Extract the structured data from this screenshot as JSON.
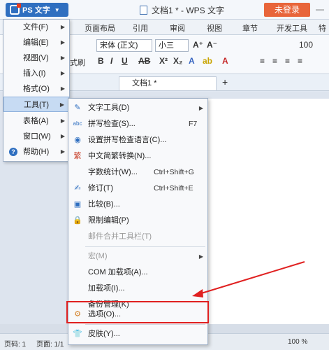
{
  "app": {
    "logo_label": "PS 文字",
    "title": "文档1 * - WPS 文字",
    "login": "未登录"
  },
  "ribbon_tabs": [
    "页面布局",
    "引用",
    "审阅",
    "视图",
    "章节",
    "开发工具",
    "特色"
  ],
  "toolbar": {
    "font_name": "宋体 (正文)",
    "font_size": "小三",
    "format_painter": "式刷",
    "zoom_label": "100"
  },
  "doc_tab": {
    "label": "文档1 *"
  },
  "main_menu": [
    {
      "label": "文件(F)"
    },
    {
      "label": "编辑(E)"
    },
    {
      "label": "视图(V)"
    },
    {
      "label": "插入(I)"
    },
    {
      "label": "格式(O)"
    },
    {
      "label": "工具(T)"
    },
    {
      "label": "表格(A)"
    },
    {
      "label": "窗口(W)"
    },
    {
      "label": "帮助(H)"
    }
  ],
  "tools_menu": [
    {
      "label": "文字工具(D)",
      "shortcut": ""
    },
    {
      "label": "拼写检查(S)...",
      "shortcut": "F7"
    },
    {
      "label": "设置拼写检查语言(C)...",
      "shortcut": ""
    },
    {
      "label": "中文简繁转换(N)...",
      "shortcut": ""
    },
    {
      "label": "字数统计(W)...",
      "shortcut": "Ctrl+Shift+G"
    },
    {
      "label": "修订(T)",
      "shortcut": "Ctrl+Shift+E"
    },
    {
      "label": "比较(B)...",
      "shortcut": ""
    },
    {
      "label": "限制编辑(P)",
      "shortcut": ""
    },
    {
      "label": "邮件合并工具栏(T)",
      "shortcut": ""
    },
    {
      "label": "宏(M)",
      "shortcut": ""
    },
    {
      "label": "COM 加载项(A)...",
      "shortcut": ""
    },
    {
      "label": "加载项(I)...",
      "shortcut": ""
    },
    {
      "label": "备份管理(K)",
      "shortcut": ""
    },
    {
      "label": "选项(O)...",
      "shortcut": ""
    },
    {
      "label": "皮肤(Y)...",
      "shortcut": ""
    }
  ],
  "status": {
    "page": "页码: 1",
    "pages": "页面: 1/1",
    "zoom": "100 %"
  },
  "colors": {
    "accent": "#2f6fc0",
    "login": "#e8653a",
    "highlight": "#e02020"
  }
}
